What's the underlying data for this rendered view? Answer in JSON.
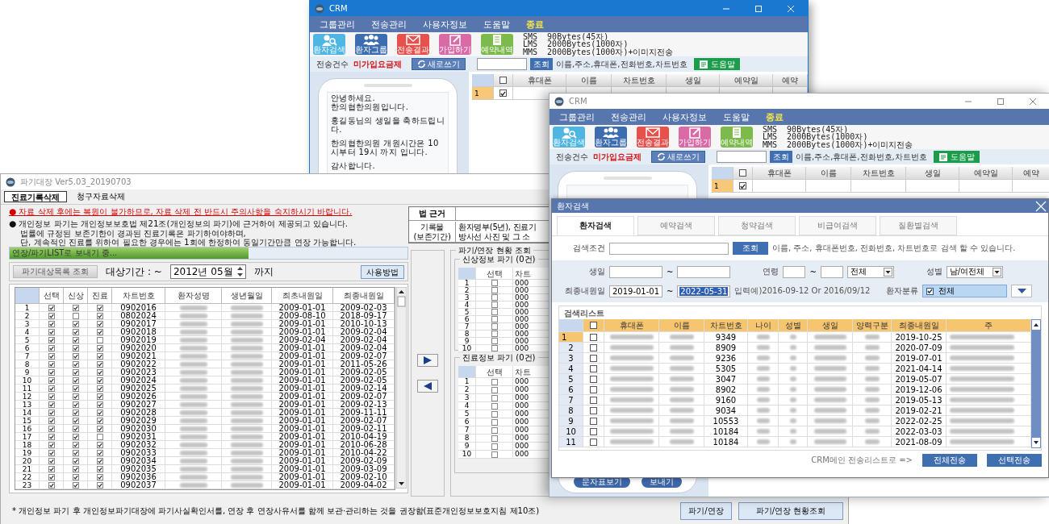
{
  "crm_back": {
    "title": "CRM",
    "active": true,
    "menu": [
      {
        "label": "그룹관리",
        "kind": "item"
      },
      {
        "label": "전송관리",
        "kind": "item"
      },
      {
        "label": "사용자정보",
        "kind": "item"
      },
      {
        "label": "도움말",
        "kind": "item"
      },
      {
        "label": "종료",
        "kind": "exit"
      }
    ],
    "toolbar": [
      {
        "label": "환자검색",
        "kind": "person-search",
        "color": "#4fb6e3"
      },
      {
        "label": "환자그룹",
        "kind": "group",
        "color": "#3c6db0"
      },
      {
        "label": "전송결과",
        "kind": "mail",
        "color": "#e6514c"
      },
      {
        "label": "가입하기",
        "kind": "edit",
        "color": "#d86aa6"
      },
      {
        "label": "예약내역",
        "kind": "list",
        "color": "#7cba4b"
      }
    ],
    "message_info": [
      "SMS  90Bytes(45자)",
      "LMS  2000Bytes(1000자)",
      "MMS  2000Bytes(1000자)+이미지전송"
    ],
    "send_count_label": "전송건수",
    "plan_label": "미가입요금제",
    "new_button": "새로쓰기",
    "search_button": "조회",
    "search_hint": "이름,주소,휴대폰,전화번호,차트번호",
    "help_button": "도움말",
    "grid": {
      "header_checked": false,
      "columns": [
        "휴대폰",
        "이름",
        "차트번호",
        "생일",
        "예약일",
        "예약"
      ],
      "rows": [
        {
          "number": "1",
          "checked": true,
          "selected": true
        }
      ]
    },
    "message_paragraphs": [
      [
        "안녕하세요.",
        "한의협한의원입니다."
      ],
      [
        "홍길동님의 생일을 축하드립니다."
      ],
      [
        "한의협한의원 개원시간은 10시부터 19시 까지 입니다."
      ],
      [
        "감사합니다."
      ]
    ]
  },
  "retention_window": {
    "title": "파기대장 Ver5.03_20190703",
    "tabs": [
      {
        "label": "진료기록삭제",
        "selected": true
      },
      {
        "label": "청구자료삭제",
        "selected": false
      }
    ],
    "warning": "● 자료 삭제 후에는 복원이 불가하므로, 자료 삭제 전 반드시 주의사항을 숙지하시기 바랍니다.",
    "notice_lines": [
      "● 개인정보 파기는 개인정보보호법 제21조(개인정보의 파기)에 근거하여 제공되고 있습니다.",
      "법률에 규정된 보존기한이 경과된 진료기록은 파기하여야하며,",
      "단, 계속적인 진료를 위하여 필요한 경우에는 1회에 한정하여 동일기간만큼 연장 가능합니다."
    ],
    "law_table": {
      "header": "법 근거",
      "row_label": [
        "기록물",
        "(보존기간)"
      ],
      "row_value": [
        "환자명부(5년), 진료기",
        "방사선 사진 및 그 소"
      ]
    },
    "progress": {
      "label": "연장/파기LIST로 보내기 중...",
      "level": 0.6
    },
    "query_button": "파기대상목록 조회",
    "period_label": "대상기간 :  ~",
    "period_value": "2012년 05월",
    "period_suffix": "까지",
    "howto_button": "사용방법",
    "table": {
      "columns": [
        "선택",
        "신상",
        "진료",
        "차트번호",
        "환자성명",
        "생년월일",
        "최초내원일",
        "최종내원일"
      ],
      "rows": [
        {
          "number": "1",
          "select": true,
          "personal": true,
          "treatment": true,
          "chart": "0902016",
          "first": "2009-01-01",
          "last": "2009-02-03"
        },
        {
          "number": "2",
          "select": true,
          "personal": false,
          "treatment": true,
          "chart": "0802024",
          "first": "2009-08-10",
          "last": "2018-09-17"
        },
        {
          "number": "3",
          "select": true,
          "personal": true,
          "treatment": true,
          "chart": "0902017",
          "first": "2009-01-01",
          "last": "2010-10-13"
        },
        {
          "number": "4",
          "select": true,
          "personal": true,
          "treatment": true,
          "chart": "0902018",
          "first": "2009-01-01",
          "last": "2009-02-04"
        },
        {
          "number": "5",
          "select": true,
          "personal": true,
          "treatment": false,
          "chart": "0902019",
          "first": "2009-02-04",
          "last": "2009-02-04"
        },
        {
          "number": "6",
          "select": true,
          "personal": true,
          "treatment": true,
          "chart": "0902020",
          "first": "2009-01-01",
          "last": "2009-02-04"
        },
        {
          "number": "7",
          "select": true,
          "personal": true,
          "treatment": true,
          "chart": "0902021",
          "first": "2009-01-01",
          "last": "2009-02-07"
        },
        {
          "number": "8",
          "select": true,
          "personal": true,
          "treatment": true,
          "chart": "0902022",
          "first": "2009-01-01",
          "last": "2011-05-26"
        },
        {
          "number": "9",
          "select": true,
          "personal": true,
          "treatment": true,
          "chart": "0902023",
          "first": "2009-01-01",
          "last": "2009-02-05"
        },
        {
          "number": "10",
          "select": true,
          "personal": true,
          "treatment": true,
          "chart": "0902024",
          "first": "2009-01-01",
          "last": "2009-02-05"
        },
        {
          "number": "11",
          "select": true,
          "personal": true,
          "treatment": true,
          "chart": "0902025",
          "first": "2009-01-01",
          "last": "2009-02-14"
        },
        {
          "number": "12",
          "select": true,
          "personal": true,
          "treatment": true,
          "chart": "0902026",
          "first": "2009-01-01",
          "last": "2009-02-07"
        },
        {
          "number": "13",
          "select": true,
          "personal": true,
          "treatment": true,
          "chart": "0902027",
          "first": "2009-01-01",
          "last": "2009-02-13"
        },
        {
          "number": "14",
          "select": true,
          "personal": true,
          "treatment": true,
          "chart": "0902028",
          "first": "2009-01-01",
          "last": "2009-11-11"
        },
        {
          "number": "15",
          "select": true,
          "personal": true,
          "treatment": true,
          "chart": "0902029",
          "first": "2009-01-01",
          "last": "2009-02-07"
        },
        {
          "number": "16",
          "select": true,
          "personal": true,
          "treatment": true,
          "chart": "0902030",
          "first": "2009-01-01",
          "last": "2009-02-11"
        },
        {
          "number": "17",
          "select": true,
          "personal": true,
          "treatment": false,
          "chart": "0902031",
          "first": "2009-01-01",
          "last": "2010-04-19"
        },
        {
          "number": "18",
          "select": true,
          "personal": true,
          "treatment": true,
          "chart": "0902032",
          "first": "2009-01-01",
          "last": "2010-06-28"
        },
        {
          "number": "19",
          "select": true,
          "personal": true,
          "treatment": true,
          "chart": "0902033",
          "first": "2009-01-01",
          "last": "2010-04-22"
        },
        {
          "number": "20",
          "select": true,
          "personal": true,
          "treatment": true,
          "chart": "0902034",
          "first": "2009-01-01",
          "last": "2009-02-09"
        },
        {
          "number": "21",
          "select": true,
          "personal": true,
          "treatment": true,
          "chart": "0902035",
          "first": "2009-01-01",
          "last": "2009-03-09"
        },
        {
          "number": "22",
          "select": true,
          "personal": true,
          "treatment": true,
          "chart": "0902036",
          "first": "2009-01-01",
          "last": "2009-02-10"
        },
        {
          "number": "23",
          "select": true,
          "personal": true,
          "treatment": true,
          "chart": "0902037",
          "first": "2009-01-01",
          "last": "2009-04-02"
        }
      ]
    },
    "status_group": {
      "title": "파기/연장 현황 조회",
      "sections": [
        {
          "title": "신상정보 파기 (0건)",
          "columns": [
            "선택",
            "차트"
          ],
          "rows": [
            {
              "number": "1",
              "checked": false,
              "chart": "000"
            },
            {
              "number": "2",
              "checked": false,
              "chart": "000"
            },
            {
              "number": "3",
              "checked": false,
              "chart": "000"
            },
            {
              "number": "4",
              "checked": false,
              "chart": "000"
            },
            {
              "number": "5",
              "checked": false,
              "chart": "000"
            },
            {
              "number": "6",
              "checked": false,
              "chart": "000"
            },
            {
              "number": "7",
              "checked": false,
              "chart": "000"
            },
            {
              "number": "8",
              "checked": false,
              "chart": "000"
            },
            {
              "number": "9",
              "checked": false,
              "chart": "000"
            },
            {
              "number": "10",
              "checked": false,
              "chart": "000"
            }
          ]
        },
        {
          "title": "진료정보 파기 (0건)",
          "columns": [
            "선택",
            "차트"
          ],
          "rows": [
            {
              "number": "1",
              "checked": false,
              "chart": "000"
            },
            {
              "number": "2",
              "checked": false,
              "chart": "000"
            },
            {
              "number": "3",
              "checked": false,
              "chart": "000"
            },
            {
              "number": "4",
              "checked": false,
              "chart": "000"
            },
            {
              "number": "5",
              "checked": false,
              "chart": "000"
            },
            {
              "number": "6",
              "checked": false,
              "chart": "000"
            },
            {
              "number": "7",
              "checked": false,
              "chart": "000"
            },
            {
              "number": "8",
              "checked": false,
              "chart": "000"
            },
            {
              "number": "9",
              "checked": false,
              "chart": "000"
            },
            {
              "number": "10",
              "checked": false,
              "chart": "000"
            }
          ]
        }
      ]
    },
    "footnote": "* 개인정보 파기 후 개인정보파기대장에 파기사실확인서를, 연장 후 연장사유서를 함께 보관·관리하는 것을 권장함(표준개인정보보호지침 제10조)",
    "footer_buttons": [
      "파기/연장",
      "파기/연장 현황조회"
    ]
  },
  "crm_front": {
    "title": "CRM",
    "active": false,
    "menu": [
      {
        "label": "그룹관리",
        "kind": "item"
      },
      {
        "label": "전송관리",
        "kind": "item"
      },
      {
        "label": "사용자정보",
        "kind": "item"
      },
      {
        "label": "도움말",
        "kind": "item"
      },
      {
        "label": "종료",
        "kind": "exit"
      }
    ],
    "toolbar": [
      {
        "label": "환자검색",
        "kind": "person-search",
        "color": "#4fb6e3"
      },
      {
        "label": "환자그룹",
        "kind": "group",
        "color": "#3c6db0"
      },
      {
        "label": "전송결과",
        "kind": "mail",
        "color": "#e6514c"
      },
      {
        "label": "가입하기",
        "kind": "edit",
        "color": "#d86aa6"
      },
      {
        "label": "예약내역",
        "kind": "list",
        "color": "#7cba4b"
      }
    ],
    "message_info": [
      "SMS  90Bytes(45자)",
      "LMS  2000Bytes(1000자)",
      "MMS  2000Bytes(1000자)+이미지전송"
    ],
    "send_count_label": "전송건수",
    "plan_label": "미가입요금제",
    "new_button": "새로쓰기",
    "search_button": "조회",
    "search_hint": "이름,주소,휴대폰,전화번호,차트번호",
    "help_button": "도움말",
    "grid": {
      "header_checked": false,
      "columns": [
        "휴대폰",
        "이름",
        "차트번호",
        "생일",
        "예약일",
        "예약"
      ],
      "rows": [
        {
          "number": "1",
          "checked": true,
          "selected": true
        }
      ]
    },
    "phone_buttons": [
      "문자표보기",
      "보내기"
    ]
  },
  "patient_search_dialog": {
    "title": "환자검색",
    "tabs": [
      {
        "label": "환자검색",
        "selected": true
      },
      {
        "label": "예약검색",
        "selected": false
      },
      {
        "label": "청약검색",
        "selected": false
      },
      {
        "label": "비급여검색",
        "selected": false
      },
      {
        "label": "질환별검색",
        "selected": false
      }
    ],
    "condition_label": "검색조건",
    "search_button": "조회",
    "search_hint": "이름, 주소, 휴대폰번호, 전화번호, 차트번호로 검색 할 수 있습니다.",
    "birthday_label": "생일",
    "range_sep": "~",
    "age_label": "연령",
    "age_select": "전체",
    "gender_label": "성별",
    "gender_select": "남/여전체",
    "last_visit_label": "최종내원일",
    "last_visit_from": "2019-01-01",
    "last_visit_to": "2022-05-31",
    "last_visit_to_highlighted": true,
    "date_hint": "입력예)2016-09-12 Or 2016/09/12",
    "category_label": "환자분류",
    "category": {
      "checked": true,
      "label": "전체"
    },
    "list_title": "검색리스트",
    "grid": {
      "header_checked": false,
      "columns": [
        "휴대폰",
        "이름",
        "차트번호",
        "나이",
        "성별",
        "생일",
        "양력구분",
        "최종내원일",
        "주"
      ],
      "rows": [
        {
          "number": "1",
          "checked": false,
          "selected": true,
          "chart": "9349",
          "last_visit": "2019-10-25"
        },
        {
          "number": "2",
          "checked": false,
          "selected": false,
          "chart": "8909",
          "last_visit": "2020-07-09"
        },
        {
          "number": "3",
          "checked": false,
          "selected": false,
          "chart": "9236",
          "last_visit": "2019-07-01"
        },
        {
          "number": "4",
          "checked": false,
          "selected": false,
          "chart": "5305",
          "last_visit": "2021-04-14"
        },
        {
          "number": "5",
          "checked": false,
          "selected": false,
          "chart": "3047",
          "last_visit": "2019-05-07"
        },
        {
          "number": "6",
          "checked": false,
          "selected": false,
          "chart": "8902",
          "last_visit": "2019-12-06"
        },
        {
          "number": "7",
          "checked": false,
          "selected": false,
          "chart": "9160",
          "last_visit": "2019-05-13"
        },
        {
          "number": "8",
          "checked": false,
          "selected": false,
          "chart": "9034",
          "last_visit": "2019-02-21"
        },
        {
          "number": "9",
          "checked": false,
          "selected": false,
          "chart": "10553",
          "last_visit": "2022-02-25"
        },
        {
          "number": "10",
          "checked": false,
          "selected": false,
          "chart": "10184",
          "last_visit": "2022-03-03"
        },
        {
          "number": "11",
          "checked": false,
          "selected": false,
          "chart": "10184",
          "last_visit": "2021-08-09"
        }
      ]
    },
    "send_hint": "CRM메인 전송리스트로 =>",
    "buttons": [
      "전체전송",
      "선택전송"
    ]
  }
}
